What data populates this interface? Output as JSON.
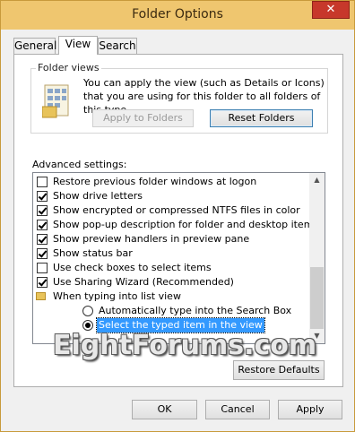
{
  "window": {
    "title": "Folder Options",
    "close_glyph": "✕"
  },
  "tabs": [
    {
      "label": "General",
      "active": false
    },
    {
      "label": "View",
      "active": true
    },
    {
      "label": "Search",
      "active": false
    }
  ],
  "folder_views": {
    "group_label": "Folder views",
    "description": "You can apply the view (such as Details or Icons) that you are using for this folder to all folders of this type.",
    "icon": "folder-views-icon",
    "apply_label": "Apply to Folders",
    "reset_label": "Reset Folders",
    "reset_underline": "R"
  },
  "advanced": {
    "label": "Advanced settings:",
    "items": [
      {
        "kind": "checkbox",
        "checked": false,
        "text": "Restore previous folder windows at logon"
      },
      {
        "kind": "checkbox",
        "checked": true,
        "text": "Show drive letters"
      },
      {
        "kind": "checkbox",
        "checked": true,
        "text": "Show encrypted or compressed NTFS files in color"
      },
      {
        "kind": "checkbox",
        "checked": true,
        "text": "Show pop-up description for folder and desktop items"
      },
      {
        "kind": "checkbox",
        "checked": true,
        "text": "Show preview handlers in preview pane"
      },
      {
        "kind": "checkbox",
        "checked": true,
        "text": "Show status bar"
      },
      {
        "kind": "checkbox",
        "checked": false,
        "text": "Use check boxes to select items"
      },
      {
        "kind": "checkbox",
        "checked": true,
        "text": "Use Sharing Wizard (Recommended)"
      },
      {
        "kind": "folder",
        "text": "When typing into list view"
      },
      {
        "kind": "radio",
        "selected": false,
        "text": "Automatically type into the Search Box"
      },
      {
        "kind": "radio",
        "selected": true,
        "text": "Select the typed item in the view"
      }
    ],
    "scroll_up": "▲",
    "scroll_down": "▼"
  },
  "watermark": "EightForums.com",
  "restore_defaults_label": "Restore Defaults",
  "footer": {
    "ok_label": "OK",
    "cancel_label": "Cancel",
    "apply_label": "Apply"
  }
}
